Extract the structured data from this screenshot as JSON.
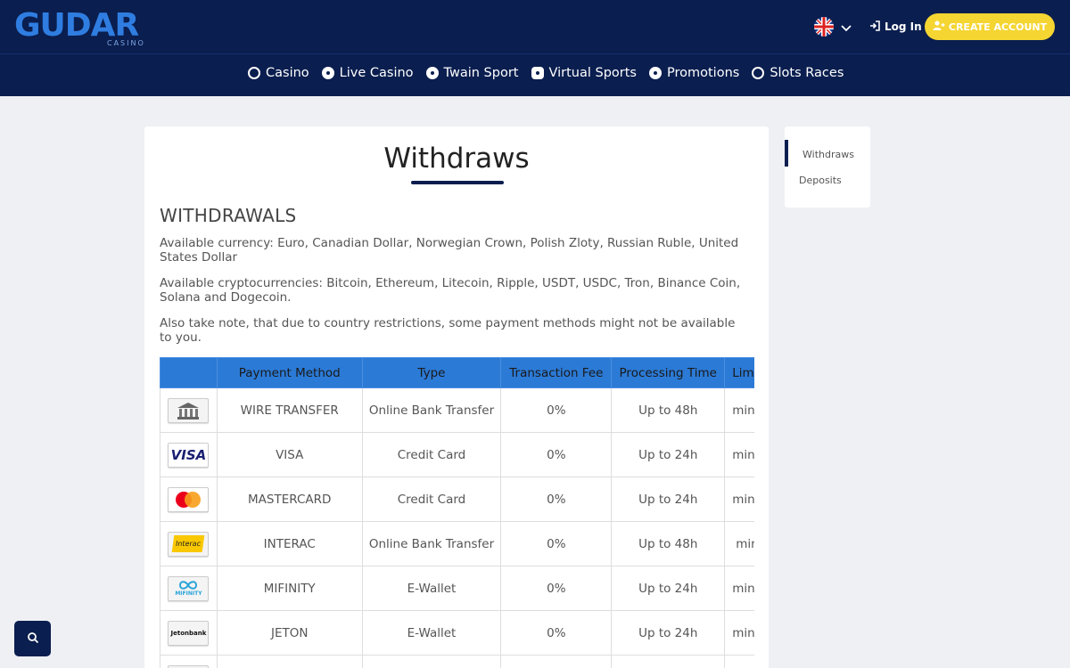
{
  "header": {
    "logo_text": "GUDAR",
    "logo_sub": "CASINO",
    "login_label": "Log In",
    "create_account_label": "CREATE ACCOUNT",
    "colors": {
      "bg": "#0a1e4f",
      "accent": "#f5d531"
    }
  },
  "nav": {
    "items": [
      {
        "label": "Casino",
        "icon": "casino-icon"
      },
      {
        "label": "Live Casino",
        "icon": "live-casino-icon"
      },
      {
        "label": "Twain Sport",
        "icon": "sport-icon"
      },
      {
        "label": "Virtual Sports",
        "icon": "virtual-sports-icon"
      },
      {
        "label": "Promotions",
        "icon": "gift-icon"
      },
      {
        "label": "Slots Races",
        "icon": "trophy-icon"
      }
    ]
  },
  "main": {
    "title": "Withdraws",
    "section_heading": "WITHDRAWALS",
    "paragraphs": [
      "Available currency: Euro, Canadian Dollar, Norwegian Crown, Polish Zloty, Russian Ruble, United States Dollar",
      "Available cryptocurrencies: Bitcoin, Ethereum, Litecoin, Ripple, USDT, USDC, Tron, Binance Coin, Solana and Dogecoin.",
      "Also take note, that due to country restrictions, some payment methods might not be available to you."
    ],
    "table": {
      "headers": [
        "",
        "Payment Method",
        "Type",
        "Transaction Fee",
        "Processing Time",
        "Limits"
      ],
      "rows": [
        {
          "logo": "bank-icon",
          "method": "WIRE TRANSFER",
          "type": "Online Bank Transfer",
          "fee": "0%",
          "time": "Up to 48h",
          "limit": "min"
        },
        {
          "logo": "visa-icon",
          "method": "VISA",
          "type": "Credit Card",
          "fee": "0%",
          "time": "Up to 24h",
          "limit": "min"
        },
        {
          "logo": "mastercard-icon",
          "method": "MASTERCARD",
          "type": "Credit Card",
          "fee": "0%",
          "time": "Up to 24h",
          "limit": "min"
        },
        {
          "logo": "interac-icon",
          "method": "INTERAC",
          "type": "Online Bank Transfer",
          "fee": "0%",
          "time": "Up to 48h",
          "limit": "min"
        },
        {
          "logo": "mifinity-icon",
          "method": "MIFINITY",
          "type": "E-Wallet",
          "fee": "0%",
          "time": "Up to 24h",
          "limit": "min"
        },
        {
          "logo": "jetonbank-icon",
          "method": "JETON",
          "type": "E-Wallet",
          "fee": "0%",
          "time": "Up to 24h",
          "limit": "min"
        },
        {
          "logo": "crypto-icon",
          "method": "",
          "type": "",
          "fee": "",
          "time": "",
          "limit": ""
        }
      ]
    }
  },
  "sidebar": {
    "items": [
      {
        "label": "Withdraws",
        "active": true
      },
      {
        "label": "Deposits",
        "active": false
      }
    ]
  },
  "logo_text": {
    "visa": "VISA",
    "interac": "Interac",
    "mifinity": "MIFINITY",
    "jetonbank": "Jetonbank"
  }
}
